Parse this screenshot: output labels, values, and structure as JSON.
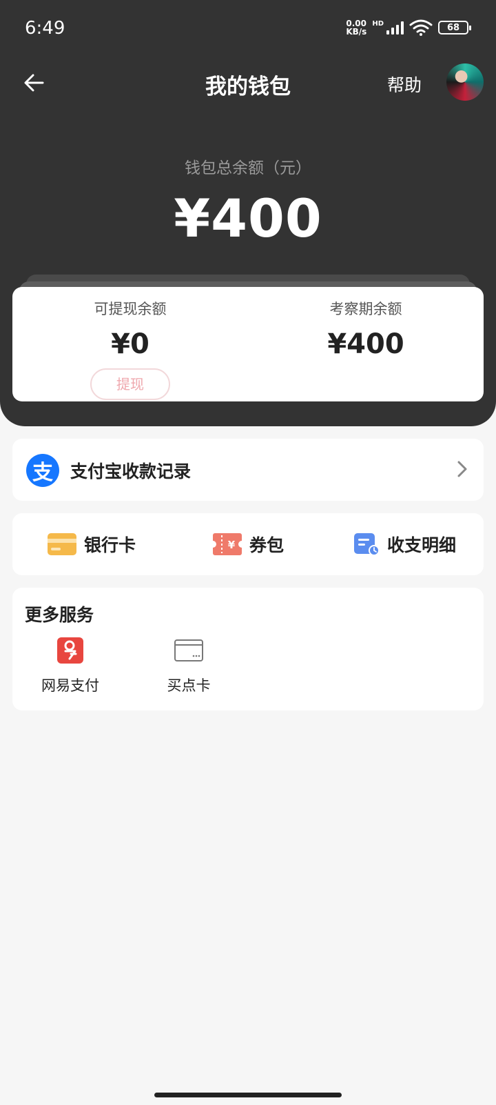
{
  "status_bar": {
    "time": "6:49",
    "net_speed_top": "0.00",
    "net_speed_bottom": "KB/s",
    "hd": "HD",
    "battery": "68"
  },
  "nav": {
    "title": "我的钱包",
    "help_label": "帮助"
  },
  "balance": {
    "label": "钱包总余额（元）",
    "amount": "¥400"
  },
  "balance_card": {
    "withdrawable_label": "可提现余额",
    "withdrawable_value": "¥0",
    "withdraw_button": "提现",
    "review_label": "考察期余额",
    "review_value": "¥400"
  },
  "alipay": {
    "icon_glyph": "支",
    "label": "支付宝收款记录"
  },
  "quick_actions": {
    "bank_card": "银行卡",
    "coupons": "券包",
    "records": "收支明细"
  },
  "services": {
    "title": "更多服务",
    "items": [
      {
        "label": "网易支付",
        "icon": "netease-pay-icon"
      },
      {
        "label": "买点卡",
        "icon": "point-card-icon"
      }
    ]
  },
  "colors": {
    "header_bg": "#333333",
    "alipay_blue": "#1677ff",
    "withdraw_disabled": "#efa7ad",
    "netease_red": "#e8463f"
  }
}
